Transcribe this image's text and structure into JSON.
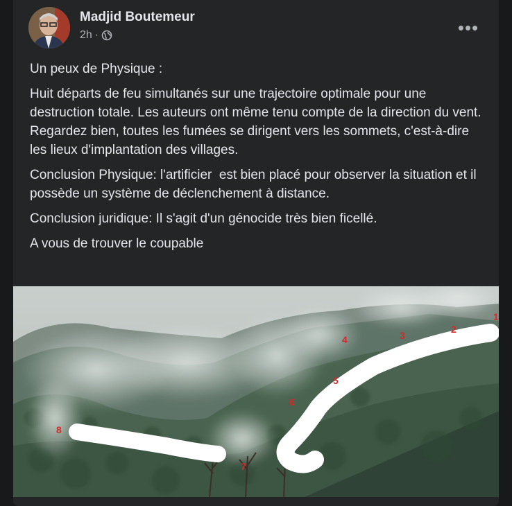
{
  "post": {
    "author": "Madjid Boutemeur",
    "time": "2h",
    "separator": "·",
    "privacy_icon": "globe-icon",
    "more_label": "•••",
    "paragraphs": [
      "Un peux de Physique :",
      "Huit départs de feu simultanés sur une trajectoire optimale pour une destruction totale. Les auteurs ont même tenu compte de la direction du vent.\nRegardez bien, toutes les fumées se dirigent vers les sommets, c'est-à-dire les lieux d'implantation des villages.",
      "Conclusion Physique: l'artificier  est bien placé pour observer la situation et il possède un système de déclenchement à distance.",
      "Conclusion juridique: Il s'agit d'un génocide très bien ficellé.",
      "A vous de trouver le coupable"
    ],
    "photo_labels": [
      "1",
      "2",
      "3",
      "4",
      "5",
      "6",
      "7",
      "8"
    ]
  },
  "colors": {
    "page_bg": "#18191a",
    "card_bg": "#242526",
    "primary_text": "#e4e6eb",
    "secondary_text": "#b0b3b8",
    "label_red": "#d12a2a"
  }
}
